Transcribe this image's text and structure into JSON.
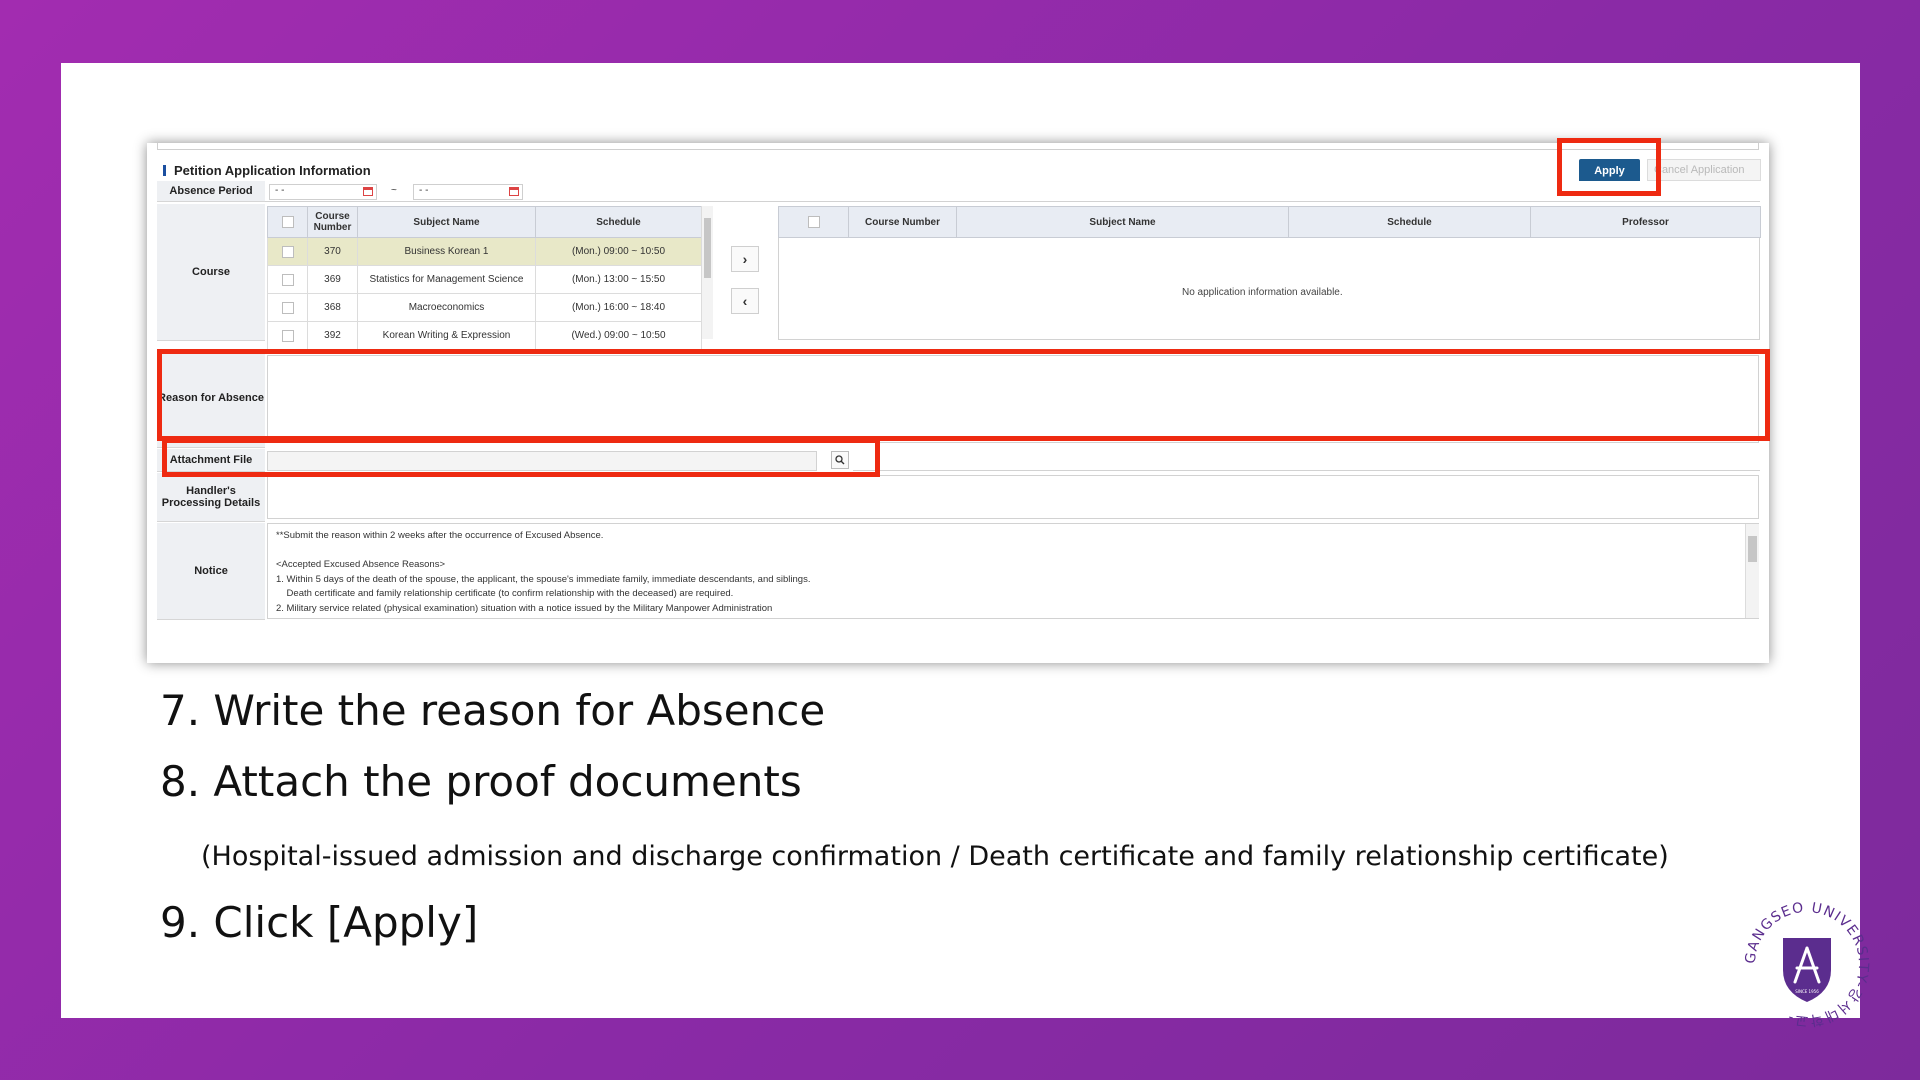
{
  "form": {
    "section_title": "Petition Application Information",
    "apply_label": "Apply",
    "cancel_label": "Cancel Application",
    "absence_period_label": "Absence Period",
    "date_start": "  -  -",
    "date_end": "  -  -",
    "date_separator": "~",
    "course_label": "Course",
    "reason_label": "Reason for Absence",
    "attachment_label": "Attachment File",
    "handler_label": "Handler's Processing Details",
    "notice_label": "Notice",
    "move_right": "›",
    "move_left": "‹",
    "left_table": {
      "headers": [
        "",
        "Course Number",
        "Subject Name",
        "Schedule"
      ],
      "rows": [
        {
          "number": "370",
          "subject": "Business Korean 1",
          "schedule": "(Mon.) 09:00 ~ 10:50",
          "selected": true
        },
        {
          "number": "369",
          "subject": "Statistics for Management Science",
          "schedule": "(Mon.) 13:00 ~ 15:50",
          "selected": false
        },
        {
          "number": "368",
          "subject": "Macroeconomics",
          "schedule": "(Mon.) 16:00 ~ 18:40",
          "selected": false
        },
        {
          "number": "392",
          "subject": "Korean Writing & Expression",
          "schedule": "(Wed.) 09:00 ~ 10:50",
          "selected": false
        }
      ]
    },
    "right_table": {
      "headers": [
        "",
        "Course Number",
        "Subject Name",
        "Schedule",
        "Professor"
      ],
      "empty_message": "No application information available."
    },
    "notice_text": "**Submit the reason within 2 weeks after the occurrence of Excused Absence.\n\n<Accepted Excused Absence Reasons>\n1. Within 5 days of the death of the spouse, the applicant, the spouse's immediate family, immediate descendants, and siblings.\n    Death certificate and family relationship certificate (to confirm relationship with the deceased) are required.\n2. Military service related (physical examination) situation with a notice issued by the Military Manpower Administration"
  },
  "steps": {
    "step7": "7. Write the reason for Absence",
    "step8": "8. Attach the proof documents",
    "step8_detail": "(Hospital-issued admission and discharge confirmation / Death certificate and family relationship certificate)",
    "step9": "9.  Click [Apply]"
  },
  "logo": {
    "ring_text": "GANGSEO UNIVERSITY-강서대학교-",
    "inner_text": "SINCE 1956"
  },
  "colors": {
    "background_purple": "#9a2cae",
    "highlight_red": "#ee2a11",
    "apply_blue": "#1c5a8e",
    "logo_purple": "#5b2d8e"
  }
}
